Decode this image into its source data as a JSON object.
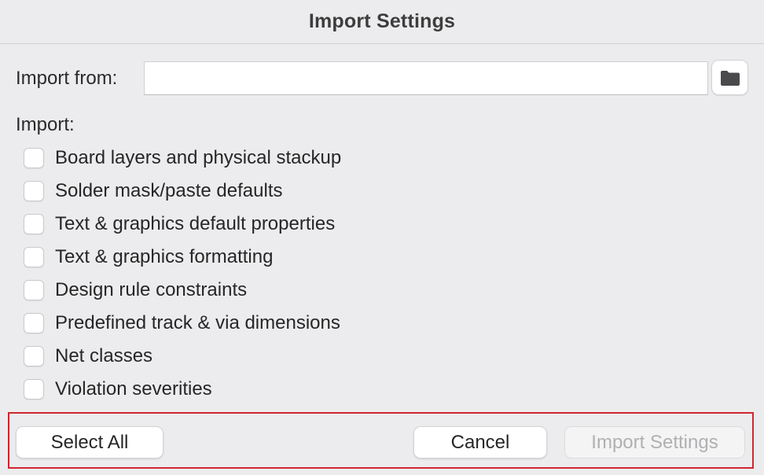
{
  "window": {
    "title": "Import Settings"
  },
  "import_from": {
    "label": "Import from:",
    "value": "",
    "browse_icon": "folder-icon"
  },
  "import_section": {
    "label": "Import:",
    "options": [
      {
        "label": "Board layers and physical stackup",
        "checked": false
      },
      {
        "label": "Solder mask/paste defaults",
        "checked": false
      },
      {
        "label": "Text & graphics default properties",
        "checked": false
      },
      {
        "label": "Text & graphics formatting",
        "checked": false
      },
      {
        "label": "Design rule constraints",
        "checked": false
      },
      {
        "label": "Predefined track & via dimensions",
        "checked": false
      },
      {
        "label": "Net classes",
        "checked": false
      },
      {
        "label": "Violation severities",
        "checked": false
      }
    ]
  },
  "buttons": {
    "select_all": "Select All",
    "cancel": "Cancel",
    "import_settings": "Import Settings",
    "import_settings_enabled": false
  },
  "colors": {
    "highlight_border": "#d0262f",
    "background": "#ececee"
  }
}
